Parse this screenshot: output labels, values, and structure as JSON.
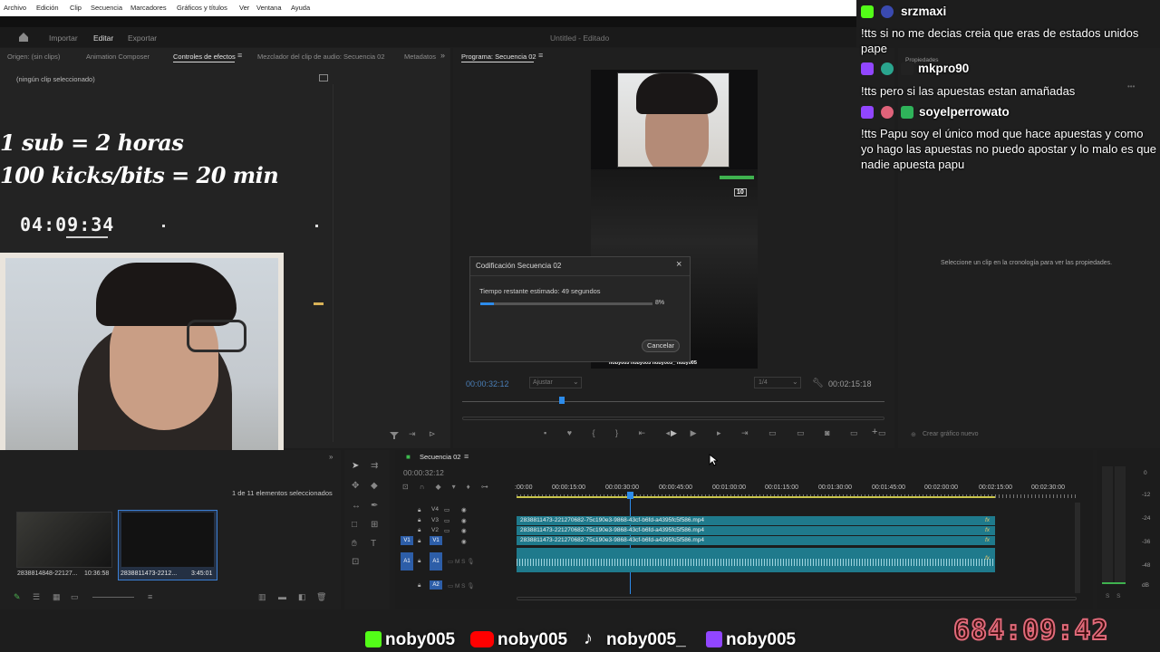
{
  "menu": [
    "Archivo",
    "Edición",
    "Clip",
    "Secuencia",
    "Marcadores",
    "Gráficos y títulos",
    "Ver",
    "Ventana",
    "Ayuda"
  ],
  "header": {
    "tabs": [
      "Importar",
      "Editar",
      "Exportar"
    ],
    "title": "Untitled - Editado"
  },
  "source_panel": {
    "tabs": [
      "Origen: (sin clips)",
      "Animation Composer",
      "Controles de efectos",
      "Mezclador del clip de audio: Secuencia 02",
      "Metadatos"
    ],
    "no_clip": "(ningún clip seleccionado)"
  },
  "overlay": {
    "rule1": "1 sub = 2 horas",
    "rule2": "100 kicks/bits = 20 min",
    "timer": "04:09:34"
  },
  "program_monitor": {
    "title": "Programa: Secuencia 02",
    "timecode": "00:00:32:12",
    "fit": "Ajustar",
    "quality": "1/4",
    "duration": "00:02:15:18",
    "hud_score": "10",
    "watermark": "noby005 noby005 noby005_ noby005"
  },
  "dialog": {
    "title": "Codificación Secuencia 02",
    "remaining": "Tiempo restante estimado: 49 segundos",
    "percent": "8%",
    "progress": 0.08,
    "cancel": "Cancelar"
  },
  "properties_panel": {
    "tab": "Propiedades",
    "hint": "Seleccione un clip en la cronología para ver las propiedades.",
    "new_graphic": "Crear gráfico nuevo"
  },
  "project_panel": {
    "selection": "1 de 11 elementos seleccionados",
    "items": [
      {
        "name": "2838814848-22127...",
        "duration": "10:36:58"
      },
      {
        "name": "2838811473-2212...",
        "duration": "3:45:01"
      }
    ]
  },
  "timeline": {
    "sequence": "Secuencia 02",
    "timecode": "00:00:32:12",
    "ruler": [
      ":00:00",
      "00:00:15:00",
      "00:00:30:00",
      "00:00:45:00",
      "00:01:00:00",
      "00:01:15:00",
      "00:01:30:00",
      "00:01:45:00",
      "00:02:00:00",
      "00:02:15:00",
      "00:02:30:00"
    ],
    "tracks": [
      "V4",
      "V3",
      "V2",
      "V1",
      "A1",
      "A2"
    ],
    "clip_name": "2838811473-221270682-75c190e3-9868-43cf-b6fd-a4395fc5f586.mp4",
    "fx": "fx"
  },
  "meter": {
    "levels": [
      "0",
      "-12",
      "-24",
      "-36",
      "-48",
      "dB"
    ],
    "channels": "S S"
  },
  "chat": [
    {
      "user": "srzmaxi",
      "message": "!tts si no me decias creia que eras de estados unidos pape"
    },
    {
      "user": "mkpro90",
      "message": "!tts pero si las apuestas estan amañadas"
    },
    {
      "user": "soyelperrowato",
      "message": "!tts Papu soy el único mod que hace apuestas y como yo hago las apuestas no puedo apostar y lo malo es que nadie apuesta papu"
    }
  ],
  "banner": {
    "kick": "noby005",
    "youtube": "noby005",
    "tiktok": "noby005_",
    "twitch": "noby005",
    "timer": "684:09:42"
  },
  "colors": {
    "clip": "#1f7a8c",
    "accent_blue": "#2d8ceb",
    "kick_green": "#53fc18",
    "twitch_purple": "#9146ff",
    "youtube_red": "#ff0000"
  }
}
